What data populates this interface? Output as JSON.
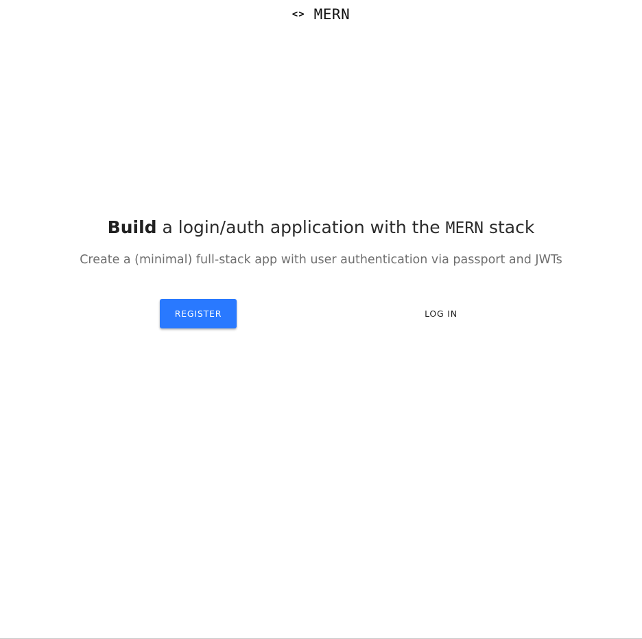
{
  "navbar": {
    "brand_icon": "<>",
    "brand_text": "MERN"
  },
  "hero": {
    "headline_bold": "Build",
    "headline_middle": " a login/auth application with the ",
    "headline_mono": "MERN",
    "headline_end": " stack",
    "subtitle": "Create a (minimal) full-stack app with user authentication via passport and JWTs"
  },
  "actions": {
    "register_label": "REGISTER",
    "login_label": "LOG IN"
  },
  "colors": {
    "accent": "#2979ff",
    "text": "#212121",
    "muted": "#6f6f6f",
    "background": "#ffffff"
  }
}
